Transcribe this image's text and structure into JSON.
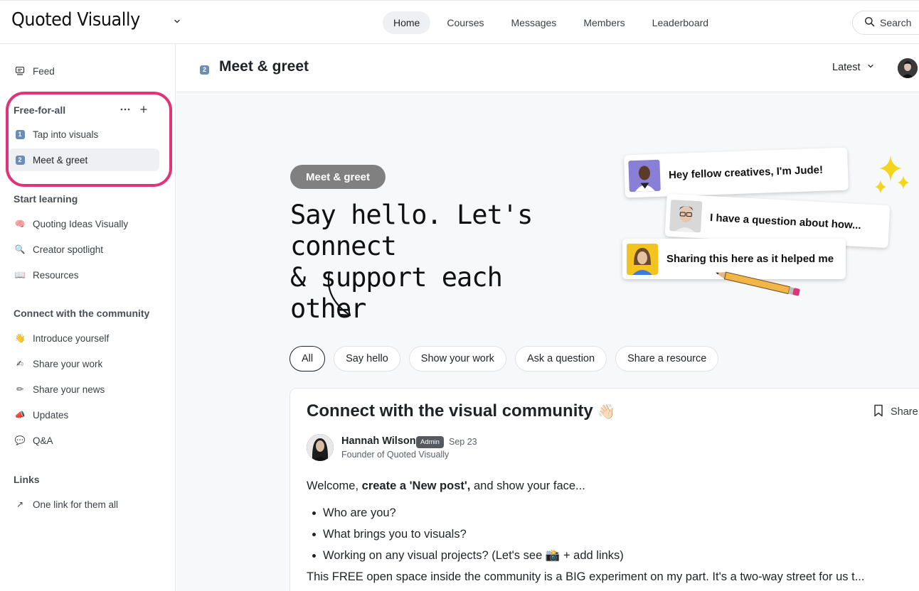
{
  "brand": {
    "name": "Quoted Visually"
  },
  "nav": {
    "items": [
      {
        "label": "Home",
        "active": true
      },
      {
        "label": "Courses",
        "active": false
      },
      {
        "label": "Messages",
        "active": false
      },
      {
        "label": "Members",
        "active": false
      },
      {
        "label": "Leaderboard",
        "active": false
      }
    ]
  },
  "search": {
    "label": "Search"
  },
  "sidebar": {
    "feed": {
      "label": "Feed",
      "icon": "feed-icon"
    },
    "groups": [
      {
        "title": "Free-for-all",
        "items": [
          {
            "label": "Tap into visuals",
            "icon": "1",
            "active": false
          },
          {
            "label": "Meet & greet",
            "icon": "2",
            "active": true
          }
        ]
      },
      {
        "title": "Start learning",
        "items": [
          {
            "label": "Quoting Ideas Visually",
            "icon": "🧠"
          },
          {
            "label": "Creator spotlight",
            "icon": "🔍"
          },
          {
            "label": "Resources",
            "icon": "📖"
          }
        ]
      },
      {
        "title": "Connect with the community",
        "items": [
          {
            "label": "Introduce yourself",
            "icon": "👋"
          },
          {
            "label": "Share your work",
            "icon": "✍"
          },
          {
            "label": "Share your news",
            "icon": "✏"
          },
          {
            "label": "Updates",
            "icon": "📣"
          },
          {
            "label": "Q&A",
            "icon": "💬"
          }
        ]
      },
      {
        "title": "Links",
        "items": [
          {
            "label": "One link for them all",
            "icon": "↗"
          }
        ]
      }
    ],
    "highlight_color": "#e0337a"
  },
  "space": {
    "icon": "2",
    "title": "Meet & greet",
    "sort_label": "Latest"
  },
  "banner": {
    "pill": "Meet & greet",
    "headline_line1": "Say hello. Let's connect",
    "headline_line2": "& support each other",
    "cards": [
      "Hey fellow creatives, I'm Jude!",
      "I have a question about how...",
      "Sharing this here as it helped me"
    ]
  },
  "filters": [
    {
      "label": "All",
      "active": true
    },
    {
      "label": "Say hello",
      "active": false
    },
    {
      "label": "Show your work",
      "active": false
    },
    {
      "label": "Ask a question",
      "active": false
    },
    {
      "label": "Share a resource",
      "active": false
    }
  ],
  "post": {
    "title": "Connect with the visual community",
    "title_emoji": "👋🏻",
    "share_label": "Share",
    "author": {
      "name": "Hannah Wilson",
      "badge": "Admin",
      "date": "Sep 23",
      "role": "Founder of Quoted Visually"
    },
    "intro_before": "Welcome, ",
    "intro_bold": "create a 'New post',",
    "intro_after": " and show your face...",
    "bullets": [
      "Who are you?",
      "What brings you to visuals?",
      "Working on any visual projects? (Let's see 📸 + add links)"
    ],
    "closing": "This FREE open space inside the community is a BIG experiment on my part. It's a two-way street for us t..."
  }
}
